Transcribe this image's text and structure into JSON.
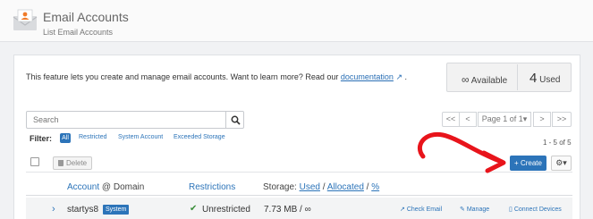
{
  "header": {
    "title": "Email Accounts",
    "subtitle": "List Email Accounts"
  },
  "intro": {
    "text": "This feature lets you create and manage email accounts. Want to learn more? Read our",
    "link": "documentation",
    "after": "."
  },
  "quota": {
    "available_symbol": "∞",
    "available_label": "Available",
    "used_count": "4",
    "used_label": "Used"
  },
  "search": {
    "placeholder": "Search"
  },
  "pagination": {
    "first": "<<",
    "prev": "<",
    "page": "Page 1 of 1",
    "next": ">",
    "last": ">>"
  },
  "filter": {
    "label": "Filter:",
    "options": [
      "All",
      "Restricted",
      "System Account",
      "Exceeded Storage"
    ]
  },
  "count": "1 - 5 of 5",
  "toolbar": {
    "delete_label": "Delete",
    "create_label": "+ Create",
    "settings_symbol": "⚙▾"
  },
  "table": {
    "headers": {
      "account": "Account",
      "at_domain": "@ Domain",
      "restrictions": "Restrictions",
      "storage_prefix": "Storage:",
      "used": "Used",
      "allocated": "Allocated",
      "percent": "%"
    },
    "rows": [
      {
        "account": "startys8",
        "badge": "System",
        "restriction": "Unrestricted",
        "storage": "7.73 MB / ∞",
        "actions": [
          "Check Email",
          "Manage",
          "Connect Devices"
        ]
      }
    ]
  },
  "colors": {
    "accent": "#2c74b9",
    "annotation": "#e8141b",
    "success": "#3a8e3a"
  }
}
